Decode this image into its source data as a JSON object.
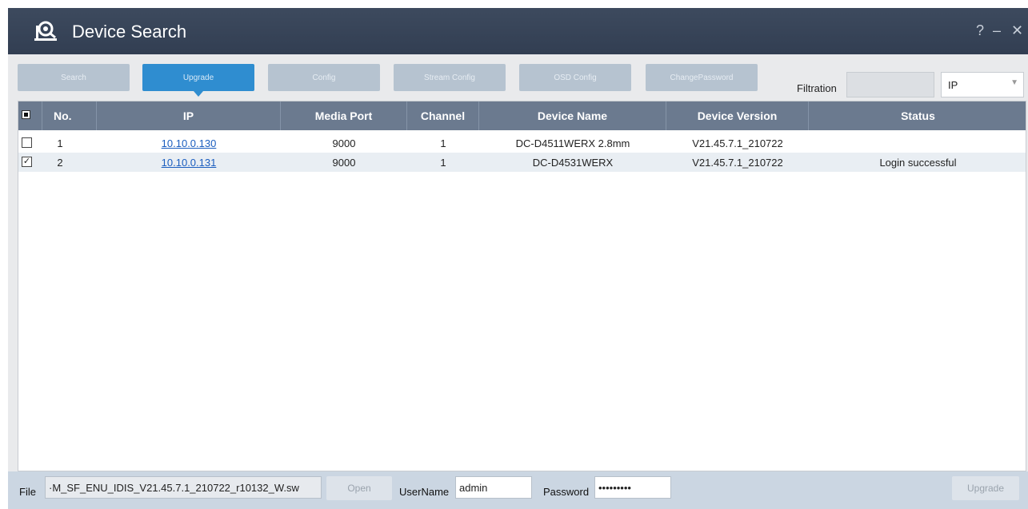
{
  "window": {
    "title": "Device Search",
    "help": "?",
    "minimize": "–",
    "close": "✕"
  },
  "toolbar": {
    "buttons": [
      "Search",
      "Upgrade",
      "Config",
      "Stream Config",
      "OSD Config",
      "ChangePassword"
    ],
    "filtration_label": "Filtration",
    "filtration_value": "",
    "filter_select": "IP"
  },
  "grid": {
    "columns": [
      "No.",
      "IP",
      "Media Port",
      "Channel",
      "Device Name",
      "Device Version",
      "Status"
    ],
    "rows": [
      {
        "checked": false,
        "no": "1",
        "ip": "10.10.0.130",
        "media_port": "9000",
        "channel": "1",
        "device_name": "DC-D4511WERX 2.8mm",
        "device_version": "V21.45.7.1_210722",
        "status": ""
      },
      {
        "checked": true,
        "no": "2",
        "ip": "10.10.0.131",
        "media_port": "9000",
        "channel": "1",
        "device_name": "DC-D4531WERX",
        "device_version": "V21.45.7.1_210722",
        "status": "Login successful"
      }
    ]
  },
  "bottom": {
    "file_label": "File",
    "file_value": "·M_SF_ENU_IDIS_V21.45.7.1_210722_r10132_W.sw",
    "open_label": "Open",
    "username_label": "UserName",
    "username_value": "admin",
    "password_label": "Password",
    "password_value": "•••••••••",
    "upgrade_label": "Upgrade"
  },
  "colors": {
    "titlebar": "#36435a",
    "header": "#6b7a8f",
    "active_button": "#2f8dd0",
    "link": "#1a5dbf"
  }
}
